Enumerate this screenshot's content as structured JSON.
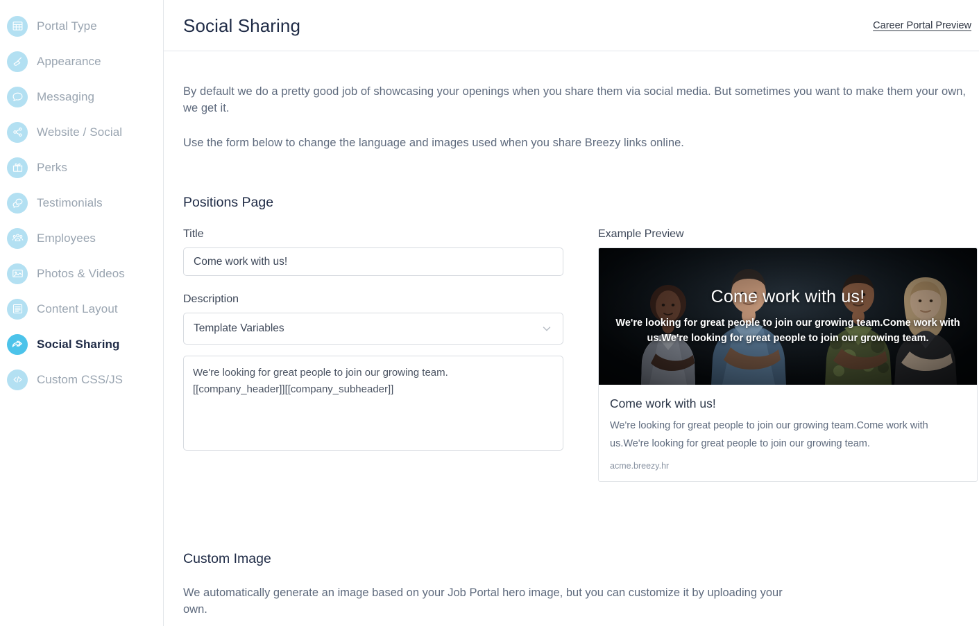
{
  "sidebar": {
    "items": [
      {
        "label": "Portal Type",
        "icon": "grid-icon",
        "active": false
      },
      {
        "label": "Appearance",
        "icon": "paintbrush-icon",
        "active": false
      },
      {
        "label": "Messaging",
        "icon": "chat-bubble-icon",
        "active": false
      },
      {
        "label": "Website / Social",
        "icon": "share-nodes-icon",
        "active": false
      },
      {
        "label": "Perks",
        "icon": "gift-icon",
        "active": false
      },
      {
        "label": "Testimonials",
        "icon": "chat-double-icon",
        "active": false
      },
      {
        "label": "Employees",
        "icon": "users-group-icon",
        "active": false
      },
      {
        "label": "Photos & Videos",
        "icon": "photo-icon",
        "active": false
      },
      {
        "label": "Content Layout",
        "icon": "list-lines-icon",
        "active": false
      },
      {
        "label": "Social Sharing",
        "icon": "share-arrow-icon",
        "active": true
      },
      {
        "label": "Custom CSS/JS",
        "icon": "code-icon",
        "active": false
      }
    ]
  },
  "header": {
    "title": "Social Sharing",
    "preview_link": "Career Portal Preview"
  },
  "intro": {
    "paragraph1": "By default we do a pretty good job of showcasing your openings when you share them via social media. But sometimes you want to make them your own, we get it.",
    "paragraph2": "Use the form below to change the language and images used when you share Breezy links online."
  },
  "positions_page": {
    "section_title": "Positions Page",
    "title_label": "Title",
    "title_value": "Come work with us!",
    "title_placeholder": "Come work with us!",
    "description_label": "Description",
    "template_select_value": "Template Variables",
    "template_select_options": [
      "Template Variables"
    ],
    "description_value": "We're looking for great people to join our growing team.\n[[company_header]][[company_subheader]]"
  },
  "preview": {
    "label": "Example Preview",
    "hero_headline": "Come work with us!",
    "hero_subtext": "We're looking for great people to join our growing team.Come work with us.We're looking for great people to join our growing team.",
    "card_title": "Come work with us!",
    "card_description": "We're looking for great people to join our growing team.Come work with us.We're looking for great people to join our growing team.",
    "card_url": "acme.breezy.hr"
  },
  "custom_image": {
    "section_title": "Custom Image",
    "body": "We automatically generate an image based on your Job Portal hero image, but you can customize it by uploading your own."
  },
  "colors": {
    "icon_circle": "#b3e0f2",
    "icon_circle_active": "#4cc3ea",
    "text_muted": "#9aa5b1",
    "text_dark": "#1f2b46",
    "border": "#e3e6ea"
  }
}
